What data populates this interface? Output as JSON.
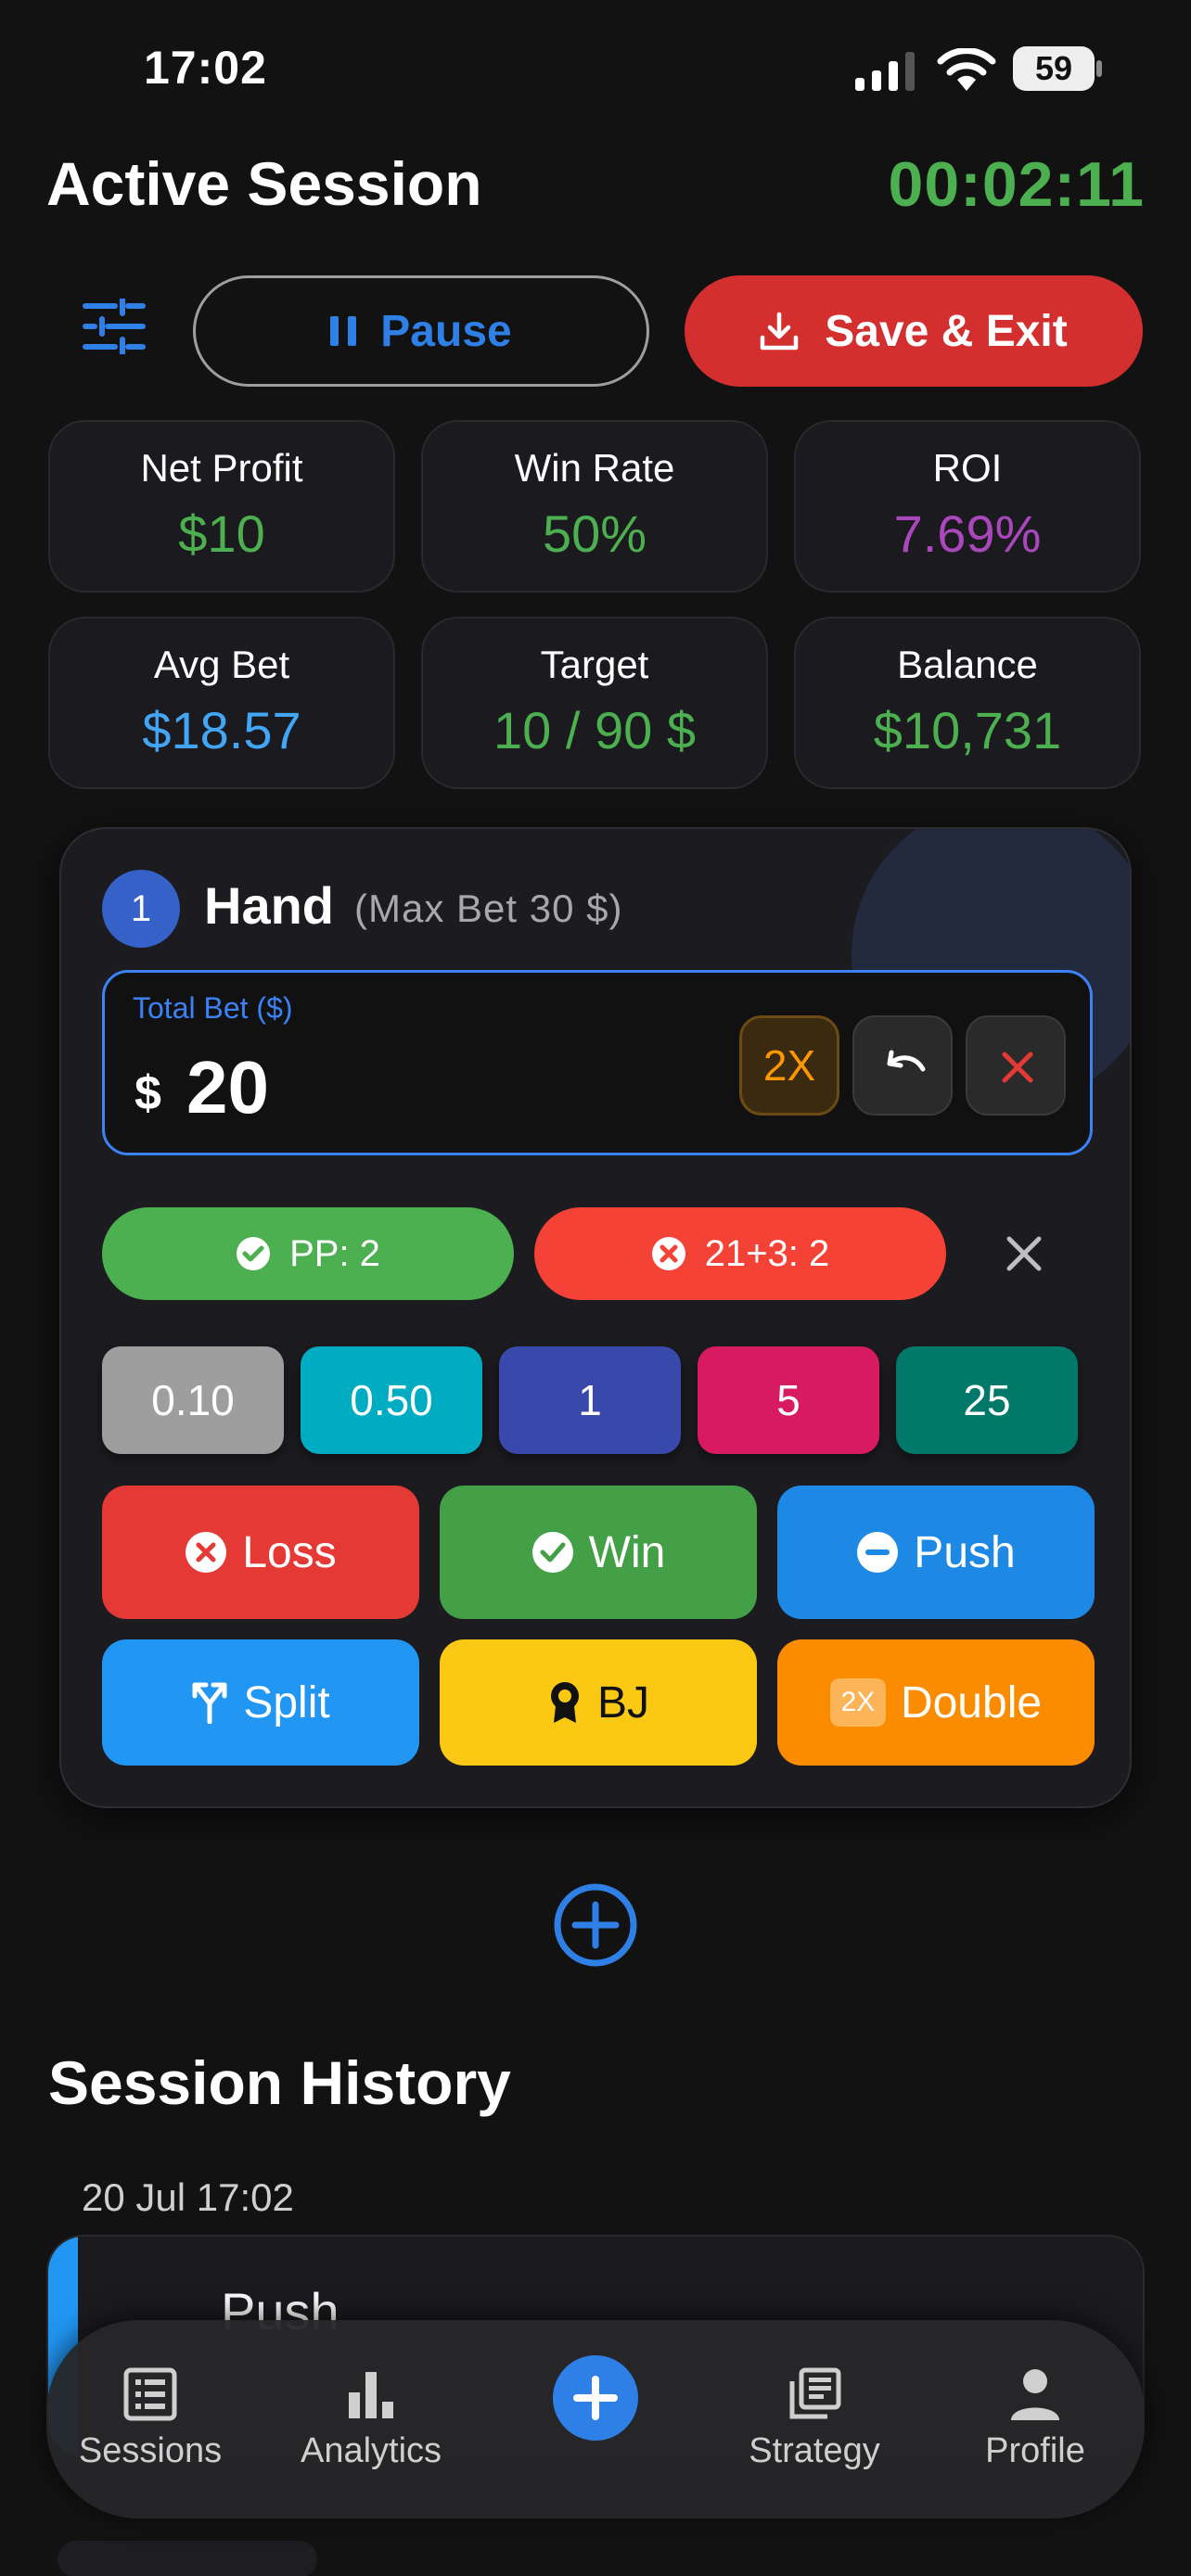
{
  "status_bar": {
    "time": "17:02",
    "battery": "59"
  },
  "header": {
    "title": "Active Session",
    "timer": "00:02:11"
  },
  "controls": {
    "pause_label": "Pause",
    "save_label": "Save & Exit"
  },
  "stats": [
    {
      "label": "Net Profit",
      "value": "$10",
      "color": "#4caf50"
    },
    {
      "label": "Win Rate",
      "value": "50%",
      "color": "#4caf50"
    },
    {
      "label": "ROI",
      "value": "7.69%",
      "color": "#ab47bc"
    },
    {
      "label": "Avg Bet",
      "value": "$18.57",
      "color": "#42a5f5"
    },
    {
      "label": "Target",
      "value": "10 / 90 $",
      "color": "#4caf50"
    },
    {
      "label": "Balance",
      "value": "$10,731",
      "color": "#4caf50"
    }
  ],
  "hand": {
    "number": "1",
    "title": "Hand",
    "subtitle": "(Max Bet 30 $)",
    "bet_label": "Total Bet ($)",
    "currency": "$",
    "bet_value": "20",
    "double_label": "2X",
    "side_bets": {
      "pp": "PP: 2",
      "twentyone_three": "21+3: 2"
    },
    "chips": [
      "0.10",
      "0.50",
      "1",
      "5",
      "25"
    ],
    "actions": {
      "loss": "Loss",
      "win": "Win",
      "push": "Push",
      "split": "Split",
      "bj": "BJ",
      "double": "Double",
      "double_badge": "2X"
    }
  },
  "history": {
    "title": "Session History",
    "entries": [
      {
        "date": "20 Jul 17:02",
        "outcome": "Push"
      }
    ]
  },
  "tabbar": {
    "sessions": "Sessions",
    "analytics": "Analytics",
    "strategy": "Strategy",
    "profile": "Profile"
  },
  "colors": {
    "accent_blue": "#2f80e6",
    "green": "#4caf50",
    "red": "#f44336",
    "save_red": "#d32f2f",
    "chip_010": "#9e9e9e",
    "chip_050": "#00acc1",
    "chip_1": "#3949ab",
    "chip_5": "#d81b60",
    "chip_25": "#00796b",
    "loss": "#e53935",
    "win": "#43a047",
    "push": "#1e88e5",
    "split": "#2196f3",
    "bj": "#fbc813",
    "double": "#fb8c00"
  }
}
